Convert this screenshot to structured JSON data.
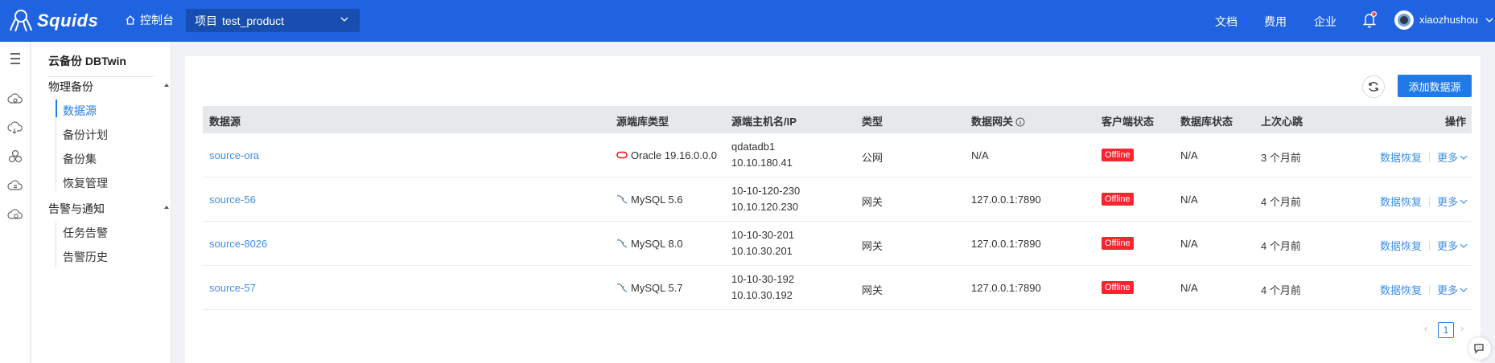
{
  "header": {
    "brand": "Squids",
    "console": "控制台",
    "project_label": "项目",
    "project_value": "test_product",
    "docs": "文档",
    "billing": "费用",
    "enterprise": "企业",
    "username": "xiaozhushou",
    "bg_color": "#1f63e0"
  },
  "sidebar": {
    "title": "云备份 DBTwin",
    "group1": "物理备份",
    "items1": [
      "数据源",
      "备份计划",
      "备份集",
      "恢复管理"
    ],
    "group2": "告警与通知",
    "items2": [
      "任务告警",
      "告警历史"
    ]
  },
  "toolbar": {
    "add_label": "添加数据源"
  },
  "table": {
    "headers": [
      "数据源",
      "源端库类型",
      "源端主机名/IP",
      "类型",
      "数据网关",
      "客户端状态",
      "数据库状态",
      "上次心跳",
      "操作"
    ],
    "rows": [
      {
        "name": "source-ora",
        "dbtype": "Oracle 19.16.0.0.0",
        "dbicon": "oracle-icon",
        "host": "qdatadb1",
        "ip": "10.10.180.41",
        "type": "公网",
        "gateway": "N/A",
        "client": "Offline",
        "dbstatus": "N/A",
        "heartbeat": "3 个月前",
        "op1": "数据恢复",
        "op2": "更多"
      },
      {
        "name": "source-56",
        "dbtype": "MySQL 5.6",
        "dbicon": "mysql-icon",
        "host": "10-10-120-230",
        "ip": "10.10.120.230",
        "type": "网关",
        "gateway": "127.0.0.1:7890",
        "client": "Offline",
        "dbstatus": "N/A",
        "heartbeat": "4 个月前",
        "op1": "数据恢复",
        "op2": "更多"
      },
      {
        "name": "source-8026",
        "dbtype": "MySQL 8.0",
        "dbicon": "mysql-icon",
        "host": "10-10-30-201",
        "ip": "10.10.30.201",
        "type": "网关",
        "gateway": "127.0.0.1:7890",
        "client": "Offline",
        "dbstatus": "N/A",
        "heartbeat": "4 个月前",
        "op1": "数据恢复",
        "op2": "更多"
      },
      {
        "name": "source-57",
        "dbtype": "MySQL 5.7",
        "dbicon": "mysql-icon",
        "host": "10-10-30-192",
        "ip": "10.10.30.192",
        "type": "网关",
        "gateway": "127.0.0.1:7890",
        "client": "Offline",
        "dbstatus": "N/A",
        "heartbeat": "4 个月前",
        "op1": "数据恢复",
        "op2": "更多"
      }
    ]
  },
  "pagination": {
    "current": "1",
    "prev": "‹",
    "next": "›"
  }
}
